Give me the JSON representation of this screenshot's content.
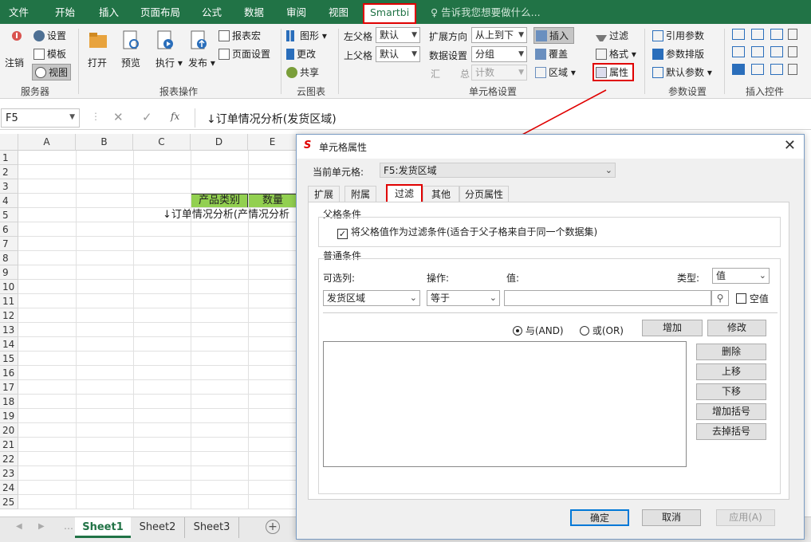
{
  "ribbon_tabs": [
    "文件",
    "开始",
    "插入",
    "页面布局",
    "公式",
    "数据",
    "审阅",
    "视图",
    "Smartbi"
  ],
  "tell_me": "告诉我您想要做什么...",
  "server_group": {
    "logout": "注销",
    "settings": "设置",
    "template": "模板",
    "view": "视图",
    "label": "服务器"
  },
  "report_group": {
    "open": "打开",
    "preview": "预览",
    "execute": "执行",
    "publish": "发布",
    "macro": "报表宏",
    "page_setup": "页面设置",
    "label": "报表操作"
  },
  "cloud_group": {
    "chart": "图形",
    "update": "更改",
    "share": "共享",
    "label": "云图表"
  },
  "cell_group": {
    "left_parent": "左父格",
    "left_parent_val": "默认",
    "up_parent": "上父格",
    "up_parent_val": "默认",
    "expand_dir": "扩展方向",
    "expand_dir_val": "从上到下",
    "data_setting": "数据设置",
    "data_setting_val": "分组",
    "sum": "汇",
    "total": "总",
    "total_val": "计数",
    "insert": "插入",
    "cover": "覆盖",
    "area": "区域",
    "filter": "过滤",
    "format": "格式",
    "property": "属性",
    "label": "单元格设置"
  },
  "param_group": {
    "ref": "引用参数",
    "layout": "参数排版",
    "default": "默认参数",
    "label": "参数设置"
  },
  "control_group": {
    "label": "插入控件"
  },
  "formula_bar": {
    "cell_ref": "F5",
    "formula": "↓订单情况分析(发货区域)"
  },
  "columns": [
    "A",
    "B",
    "C",
    "D",
    "E"
  ],
  "rows": [
    "1",
    "2",
    "3",
    "4",
    "5",
    "6",
    "7",
    "8",
    "9",
    "10",
    "11",
    "12",
    "13",
    "14",
    "15",
    "16",
    "17",
    "18",
    "19",
    "20",
    "21",
    "22",
    "23",
    "24",
    "25"
  ],
  "cells": {
    "d4": "产品类别",
    "e4": "数量",
    "c5": "↓订单情况分析(产",
    "e5": "情况分析"
  },
  "sheets": [
    "Sheet1",
    "Sheet2",
    "Sheet3"
  ],
  "dialog": {
    "title": "单元格属性",
    "current_cell_label": "当前单元格:",
    "current_cell_val": "F5:发货区域",
    "tabs": [
      "扩展",
      "附属",
      "过滤",
      "其他",
      "分页属性"
    ],
    "parent_group": "父格条件",
    "parent_checkbox": "将父格值作为过滤条件(适合于父子格来自于同一个数据集)",
    "normal_group": "普通条件",
    "col_label": "可选列:",
    "op_label": "操作:",
    "val_label": "值:",
    "type_label": "类型:",
    "type_val": "值",
    "col_val": "发货区域",
    "op_val": "等于",
    "empty_label": "空值",
    "and_label": "与(AND)",
    "or_label": "或(OR)",
    "add": "增加",
    "modify": "修改",
    "delete": "删除",
    "up": "上移",
    "down": "下移",
    "add_bracket": "增加括号",
    "remove_bracket": "去掉括号",
    "ok": "确定",
    "cancel": "取消",
    "apply": "应用(A)"
  },
  "colors": {
    "excel_green": "#217346",
    "highlight_red": "#e00000",
    "header_green": "#92d050"
  }
}
